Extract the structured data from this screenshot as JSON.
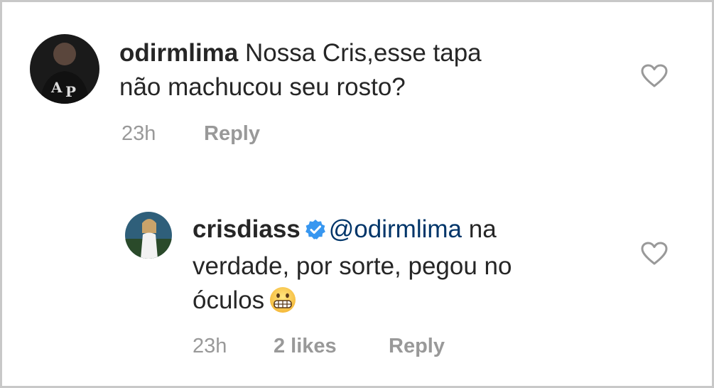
{
  "comment1": {
    "username": "odirmlima",
    "text_line1": "Nossa Cris,esse tapa",
    "text_line2": "não machucou seu rosto?",
    "time": "23h",
    "reply_label": "Reply",
    "avatar_icon": "profile-photo",
    "heart_icon": "heart-outline-icon"
  },
  "comment2": {
    "username": "crisdiass",
    "verified_icon": "verified-badge-icon",
    "mention": "@odirmlima",
    "text_part1": " na",
    "text_line2": "verdade, por sorte, pegou no",
    "text_line3": "óculos",
    "emoji": "grimacing-face-emoji",
    "time": "23h",
    "likes_label": "2 likes",
    "reply_label": "Reply",
    "avatar_icon": "profile-photo",
    "heart_icon": "heart-outline-icon"
  },
  "colors": {
    "text": "#262626",
    "mention": "#003569",
    "meta": "#999999",
    "verified": "#3897f0",
    "border": "#c8c8c8"
  }
}
